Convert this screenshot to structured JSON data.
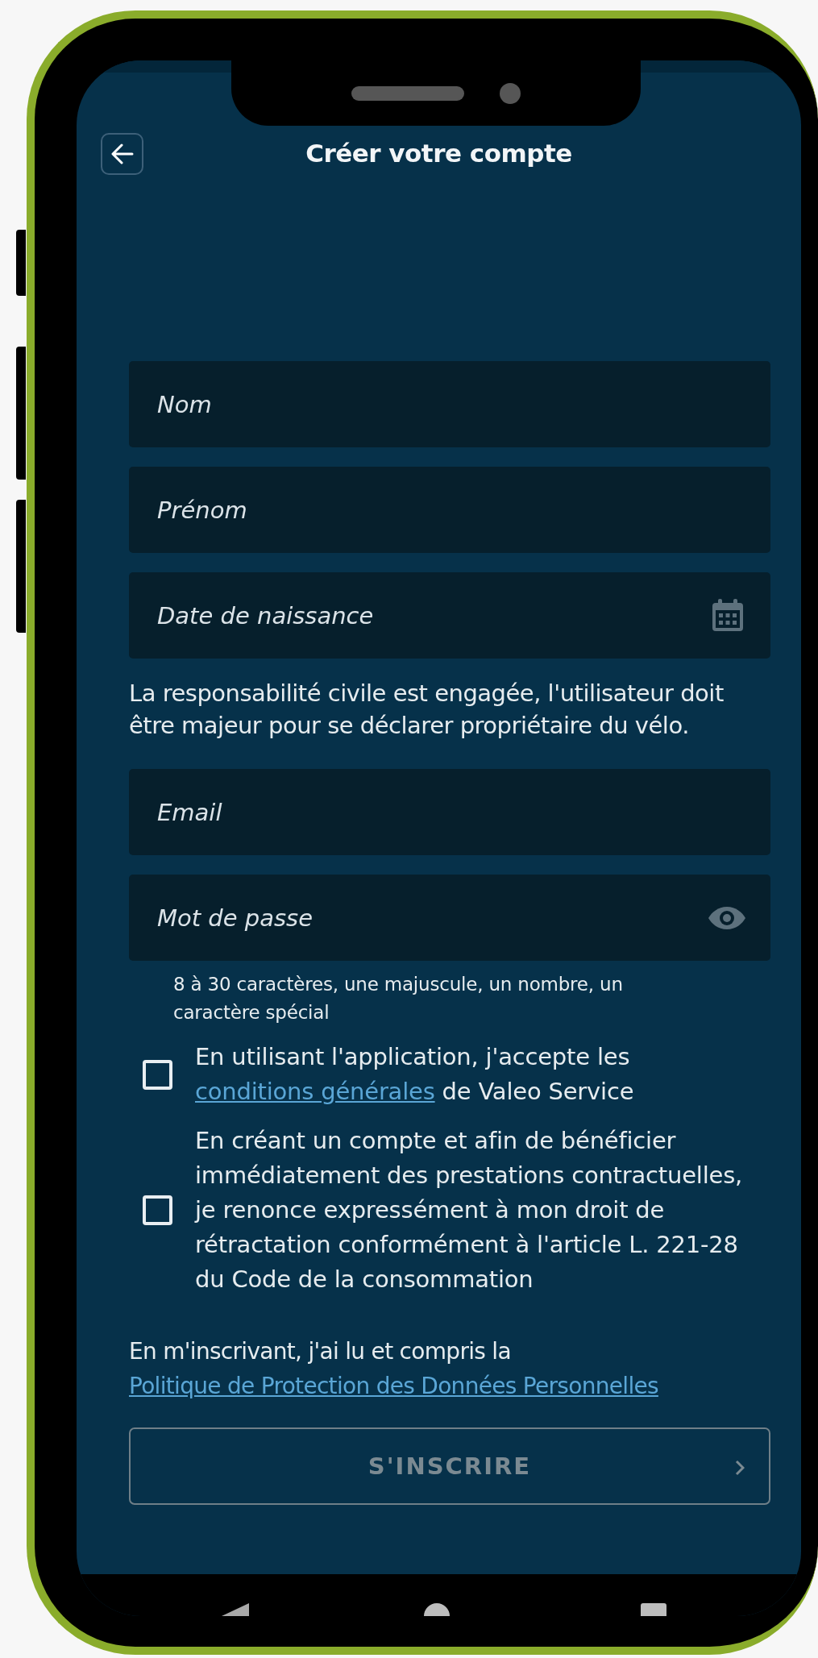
{
  "header": {
    "title": "Créer votre compte"
  },
  "form": [
    {
      "kind": "field",
      "placeholder": "Nom"
    },
    {
      "kind": "field",
      "placeholder": "Prénom"
    },
    {
      "kind": "date",
      "placeholder": "Date de naissance"
    },
    {
      "kind": "note",
      "text": "La responsabilité civile est engagée, l'utilisateur doit être majeur pour se déclarer propriétaire du vélo."
    },
    {
      "kind": "field",
      "placeholder": "Email"
    },
    {
      "kind": "password",
      "placeholder": "Mot de passe"
    },
    {
      "kind": "hint",
      "text": "8 à 30 caractères, une majuscule, un nombre, un caractère spécial"
    },
    {
      "kind": "checkbox",
      "checked": false,
      "parts": [
        {
          "text": "En utilisant l'application, j'accepte les "
        },
        {
          "text": "conditions générales",
          "link": true
        },
        {
          "text": " de Valeo Service"
        }
      ]
    },
    {
      "kind": "checkbox",
      "checked": false,
      "parts": [
        {
          "text": "En créant un compte et afin de bénéficier immédiatement des prestations contractuelles, je renonce expressément à mon droit de rétractation conformément à l'article L. 221-28 du Code de la consommation"
        }
      ]
    },
    {
      "kind": "policy",
      "parts": [
        {
          "text": "En m'inscrivant, j'ai lu et compris la "
        },
        {
          "text": "Politique de Protection des Données Personnelles",
          "link": true
        }
      ]
    }
  ],
  "submit": {
    "label": "S'INSCRIRE",
    "disabled": true
  }
}
